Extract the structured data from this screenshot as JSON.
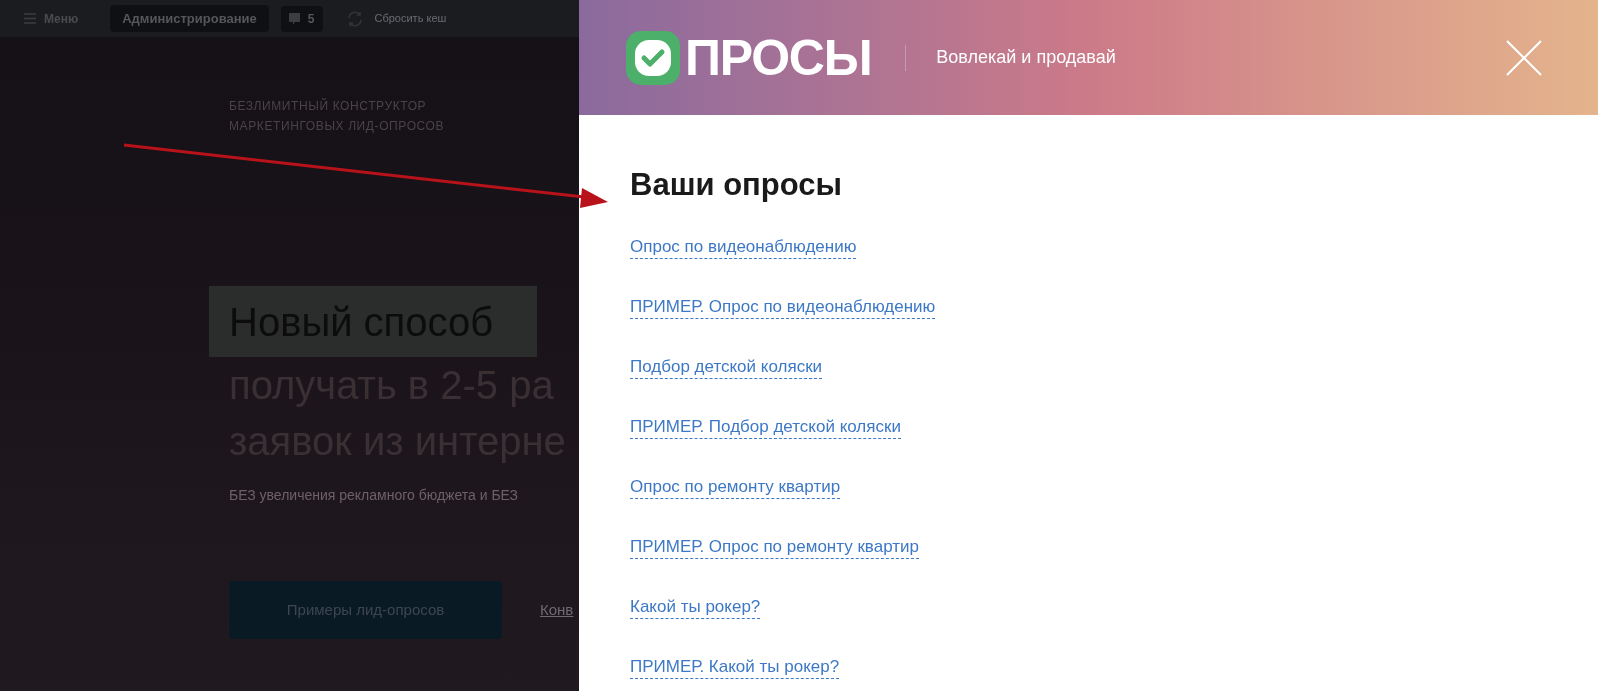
{
  "background_page": {
    "toolbar": {
      "menu": "Меню",
      "admin_button": "Администрирование",
      "notifications_count": "5",
      "reset_cache": "Сбросить кеш"
    },
    "tagline": [
      "БЕЗЛИМИТНЫЙ КОНСТРУКТОР",
      "МАРКЕТИНГОВЫХ ЛИД-ОПРОСОВ"
    ],
    "headline": [
      "Новый способ",
      "получать в 2-5 ра",
      "заявок из интерне"
    ],
    "subtitle": "БЕЗ увеличения рекламного бюджета и БЕЗ",
    "primary_button": "Примеры лид-опросов",
    "link": "Конв"
  },
  "panel": {
    "logo_text": "ПРОСЫ",
    "slogan": "Вовлекай и продавай",
    "title": "Ваши опросы",
    "polls": [
      "Опрос по видеонаблюдению",
      "ПРИМЕР. Опрос по видеонаблюдению",
      "Подбор детской коляски",
      "ПРИМЕР. Подбор детской коляски",
      "Опрос по ремонту квартир",
      "ПРИМЕР. Опрос по ремонту квартир",
      "Какой ты рокер?",
      "ПРИМЕР. Какой ты рокер?"
    ]
  }
}
